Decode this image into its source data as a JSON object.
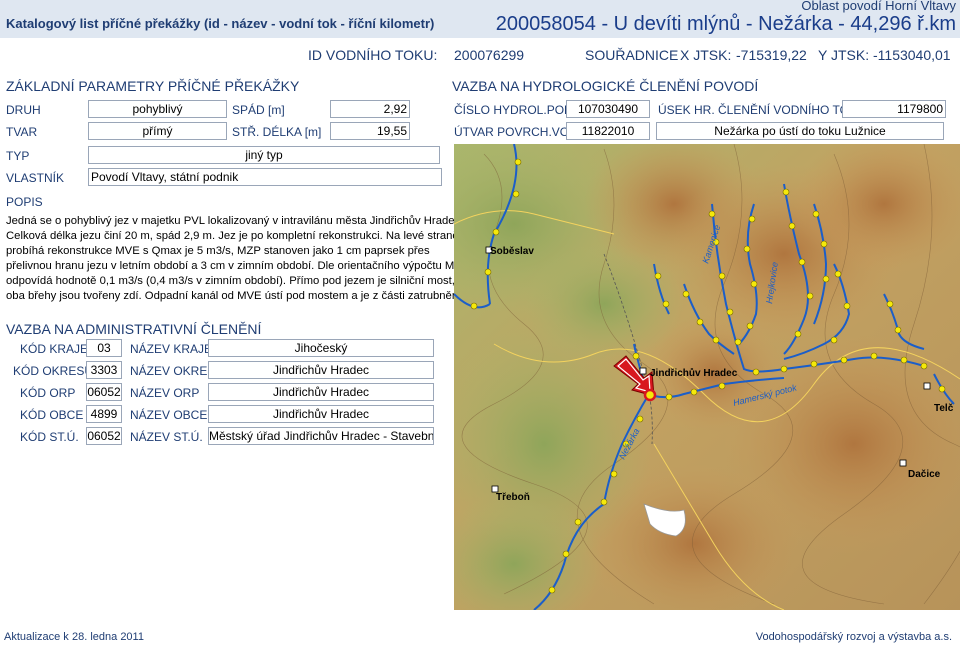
{
  "header": {
    "catalog_title": "Katalogový list příčné překážky (id - název - vodní tok - říční kilometr)",
    "organization": "Oblast povodí Horní Vltavy",
    "main_title": "200058054 - U devíti mlýnů - Nežárka - 44,296 ř.km",
    "id_label": "ID VODNÍHO TOKU:",
    "id_value": "200076299",
    "coords_label": "SOUŘADNICE",
    "x_label": "X JTSK:",
    "x_value": "-715319,22",
    "y_label": "Y JTSK:",
    "y_value": "-1153040,01"
  },
  "basic": {
    "section_title": "ZÁKLADNÍ PARAMETRY PŘÍČNÉ PŘEKÁŽKY",
    "druh_label": "DRUH",
    "druh_value": "pohyblivý",
    "spad_label": "SPÁD [m]",
    "spad_value": "2,92",
    "tvar_label": "TVAR",
    "tvar_value": "přímý",
    "delka_label": "STŘ. DÉLKA [m]",
    "delka_value": "19,55",
    "typ_label": "TYP",
    "typ_value": "jiný typ",
    "vlastnik_label": "VLASTNÍK",
    "vlastnik_value": "Povodí Vltavy, státní podnik",
    "popis_label": "POPIS",
    "popis_text": [
      "Jedná se o pohyblivý jez v majetku PVL lokalizovaný v intravilánu města Jindřichův Hradec.",
      "Celková délka jezu činí 20 m, spád 2,9 m. Jez je po kompletní rekonstrukci. Na levé straně",
      "probíhá rekonstrukce MVE s Qmax je 5 m3/s, MZP stanoven jako 1 cm paprsek přes",
      "přelivnou hranu jezu v letním období a 3 cm v zimním období. Dle orientačního výpočtu MZP",
      "odpovídá hodnotě 0,1 m3/s (0,4 m3/s v zimním období). Přímo pod jezem je silniční most,",
      "oba břehy jsou tvořeny zdí. Odpadní kanál od MVE ústí pod mostem a je z části zatrubněný."
    ]
  },
  "hydro": {
    "section_title": "VAZBA NA HYDROLOGICKÉ ČLENĚNÍ POVODÍ",
    "cislo_label": "ČÍSLO HYDROL.POŘ.",
    "cislo_value": "107030490",
    "usek_label": "ÚSEK HR. ČLENĚNÍ VODNÍHO TOKU",
    "usek_value": "1179800",
    "utvar_label": "ÚTVAR POVRCH.VOD",
    "utvar_value": "11822010",
    "utvar_name": "Nežárka po ústí do toku Lužnice"
  },
  "admin": {
    "section_title": "VAZBA NA ADMINISTRATIVNÍ ČLENĚNÍ",
    "rows": [
      {
        "code_label": "KÓD KRAJE",
        "code": "03",
        "name_label": "NÁZEV KRAJE",
        "name": "Jihočeský"
      },
      {
        "code_label": "KÓD OKRESU",
        "code": "3303",
        "name_label": "NÁZEV OKRESU",
        "name": "Jindřichův Hradec"
      },
      {
        "code_label": "KÓD ORP",
        "code": "06052",
        "name_label": "NÁZEV ORP",
        "name": "Jindřichův Hradec"
      },
      {
        "code_label": "KÓD OBCE",
        "code": "4899",
        "name_label": "NÁZEV OBCE",
        "name": "Jindřichův Hradec"
      },
      {
        "code_label": "KÓD ST.Ú.",
        "code": "06052",
        "name_label": "NÁZEV ST.Ú.",
        "name": "Městský úřad Jindřichův Hradec - Stavební úřad"
      }
    ]
  },
  "map": {
    "places": [
      "Soběslav",
      "Jindřichův Hradec",
      "Telč",
      "Dačice",
      "Třeboň"
    ],
    "rivers": [
      "Kamenice",
      "Hrejkovice",
      "Nežárka",
      "Hamerský potok"
    ],
    "colors": {
      "river": "#1b5ec9",
      "station": "#f5e90a",
      "marker": "#d8181f"
    }
  },
  "footer": {
    "update_label": "Aktualizace k",
    "update_date": "28. ledna 2011",
    "credit": "Vodohospodářský rozvoj a výstavba a.s."
  }
}
